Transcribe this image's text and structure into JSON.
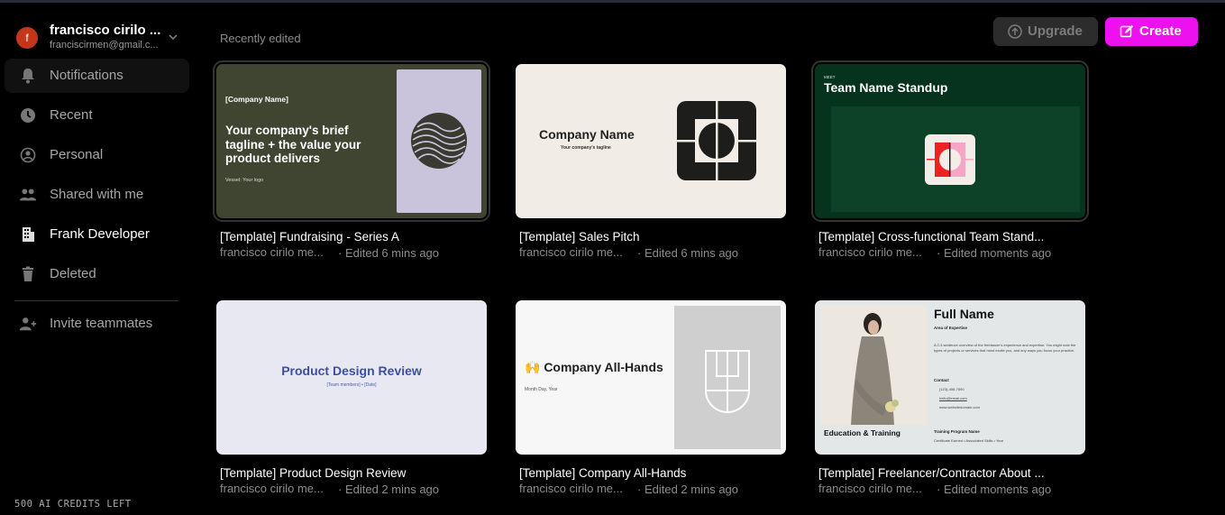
{
  "account": {
    "initial": "f",
    "name": "francisco cirilo ...",
    "email": "franciscirmen@gmail.c..."
  },
  "nav": [
    {
      "label": "Notifications",
      "icon": "bell-icon"
    },
    {
      "label": "Recent",
      "icon": "clock-icon"
    },
    {
      "label": "Personal",
      "icon": "user-circle-icon"
    },
    {
      "label": "Shared with me",
      "icon": "users-icon"
    },
    {
      "label": "Frank Developer",
      "icon": "building-icon"
    },
    {
      "label": "Deleted",
      "icon": "trash-icon"
    },
    {
      "label": "Invite teammates",
      "icon": "user-plus-icon"
    }
  ],
  "credits": "500 AI CREDITS LEFT",
  "section_title": "Recently edited",
  "buttons": {
    "upgrade": "Upgrade",
    "create": "Create"
  },
  "colors": {
    "accent": "#ee10ee",
    "avatar": "#c4361a"
  },
  "cards": [
    {
      "title": "[Template] Fundraising - Series A",
      "author": "francisco cirilo me...",
      "time": "· Edited 6 mins ago",
      "thumb": {
        "company": "[Company Name]",
        "headline": "Your company's brief tagline + the value your product delivers",
        "footer": "Vessel: Your logo"
      }
    },
    {
      "title": "[Template] Sales Pitch",
      "author": "francisco cirilo me...",
      "time": "· Edited 6 mins ago",
      "thumb": {
        "company": "Company Name",
        "tagline": "Your company's tagline"
      }
    },
    {
      "title": "[Template] Cross-functional Team Stand...",
      "author": "francisco cirilo me...",
      "time": "· Edited moments ago",
      "thumb": {
        "kicker": "MEET",
        "heading": "Team Name Standup"
      }
    },
    {
      "title": "[Template] Product Design Review",
      "author": "francisco cirilo me...",
      "time": "· Edited 2 mins ago",
      "thumb": {
        "heading": "Product Design Review",
        "sub": "[Team members] • [Date]"
      }
    },
    {
      "title": "[Template] Company All-Hands",
      "author": "francisco cirilo me...",
      "time": "· Edited 2 mins ago",
      "thumb": {
        "heading": "🙌 Company All-Hands",
        "date": "Month Day, Year"
      }
    },
    {
      "title": "[Template] Freelancer/Contractor About ...",
      "author": "francisco cirilo me...",
      "time": "· Edited moments ago",
      "thumb": {
        "name": "Full Name",
        "expertise": "Area of Expertise",
        "bio": "A 2-3 sentence overview of the freelancer's experience and expertise. You might note the types of projects or services that most excite you, and any ways you focus your practice.",
        "contact_label": "Contact",
        "contacts": [
          "(123)-456-7890",
          "hello@email.com",
          "www.websitedomain.com"
        ],
        "education": "Education & Training",
        "program": "Training Program Name",
        "program_sub": "Certificate Earned • Associated Skills • Year"
      }
    }
  ]
}
